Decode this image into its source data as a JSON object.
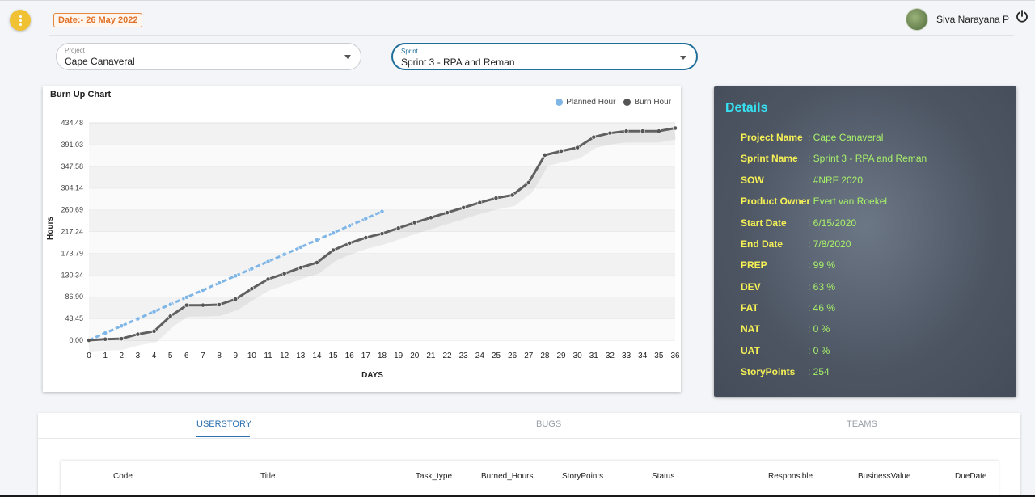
{
  "header": {
    "date_badge": "Date:- 26 May 2022",
    "user_name": "Siva Narayana P"
  },
  "filters": {
    "project": {
      "label": "Project",
      "value": "Cape Canaveral"
    },
    "sprint": {
      "label": "Sprint",
      "value": "Sprint 3 - RPA and Reman"
    }
  },
  "chart_data": {
    "type": "line",
    "title": "Burn Up Chart",
    "xlabel": "DAYS",
    "ylabel": "Hours",
    "x": [
      0,
      1,
      2,
      3,
      4,
      5,
      6,
      7,
      8,
      9,
      10,
      11,
      12,
      13,
      14,
      15,
      16,
      17,
      18,
      19,
      20,
      21,
      22,
      23,
      24,
      25,
      26,
      27,
      28,
      29,
      30,
      31,
      32,
      33,
      34,
      35,
      36
    ],
    "y_ticks": [
      "0.00",
      "43.45",
      "86.90",
      "130.34",
      "173.79",
      "217.24",
      "260.69",
      "304.14",
      "347.58",
      "391.03",
      "434.48"
    ],
    "ylim": [
      0,
      434.48
    ],
    "legend_position": "top-right",
    "grid": true,
    "series": [
      {
        "name": "Planned Hour",
        "color": "#7fb6e6",
        "dashed": true,
        "values": [
          0,
          14.3,
          28.6,
          42.9,
          57.2,
          71.5,
          85.8,
          100.1,
          114.4,
          128.7,
          143,
          157.3,
          171.6,
          185.9,
          200.2,
          214.5,
          228.8,
          243.1,
          257.4
        ]
      },
      {
        "name": "Burn Hour",
        "color": "#606060",
        "dashed": false,
        "values": [
          0,
          2,
          3,
          12,
          18,
          48,
          70,
          70,
          71,
          82,
          103,
          122,
          133,
          145,
          155,
          180,
          194,
          205,
          213,
          224,
          235,
          245,
          255,
          265,
          275,
          284,
          290,
          315,
          370,
          378,
          385,
          406,
          414,
          418,
          418,
          418,
          424
        ]
      }
    ]
  },
  "details": {
    "title": "Details",
    "rows": [
      {
        "key": "Project Name",
        "value": ": Cape Canaveral"
      },
      {
        "key": "Sprint Name",
        "value": ": Sprint 3 - RPA and Reman"
      },
      {
        "key": "SOW",
        "value": ": #NRF 2020"
      },
      {
        "key": "Product Owner",
        "value": ": Evert van Roekel"
      },
      {
        "key": "Start Date",
        "value": ": 6/15/2020"
      },
      {
        "key": "End Date",
        "value": ": 7/8/2020"
      },
      {
        "key": "PREP",
        "value": ": 99 %"
      },
      {
        "key": "DEV",
        "value": ": 63 %"
      },
      {
        "key": "FAT",
        "value": ": 46 %"
      },
      {
        "key": "NAT",
        "value": ": 0 %"
      },
      {
        "key": "UAT",
        "value": ": 0 %"
      },
      {
        "key": "StoryPoints",
        "value": ": 254"
      }
    ]
  },
  "tabs": [
    {
      "label": "USERSTORY",
      "active": true
    },
    {
      "label": "BUGS",
      "active": false
    },
    {
      "label": "TEAMS",
      "active": false
    }
  ],
  "table": {
    "columns": [
      "Code",
      "Title",
      "Task_type",
      "Burned_Hours",
      "StoryPoints",
      "Status",
      "Responsible",
      "BusinessValue",
      "DueDate"
    ]
  },
  "icons": {
    "menu": "more-vertical-icon",
    "power": "power-icon",
    "dropdown": "chevron-down-icon"
  }
}
